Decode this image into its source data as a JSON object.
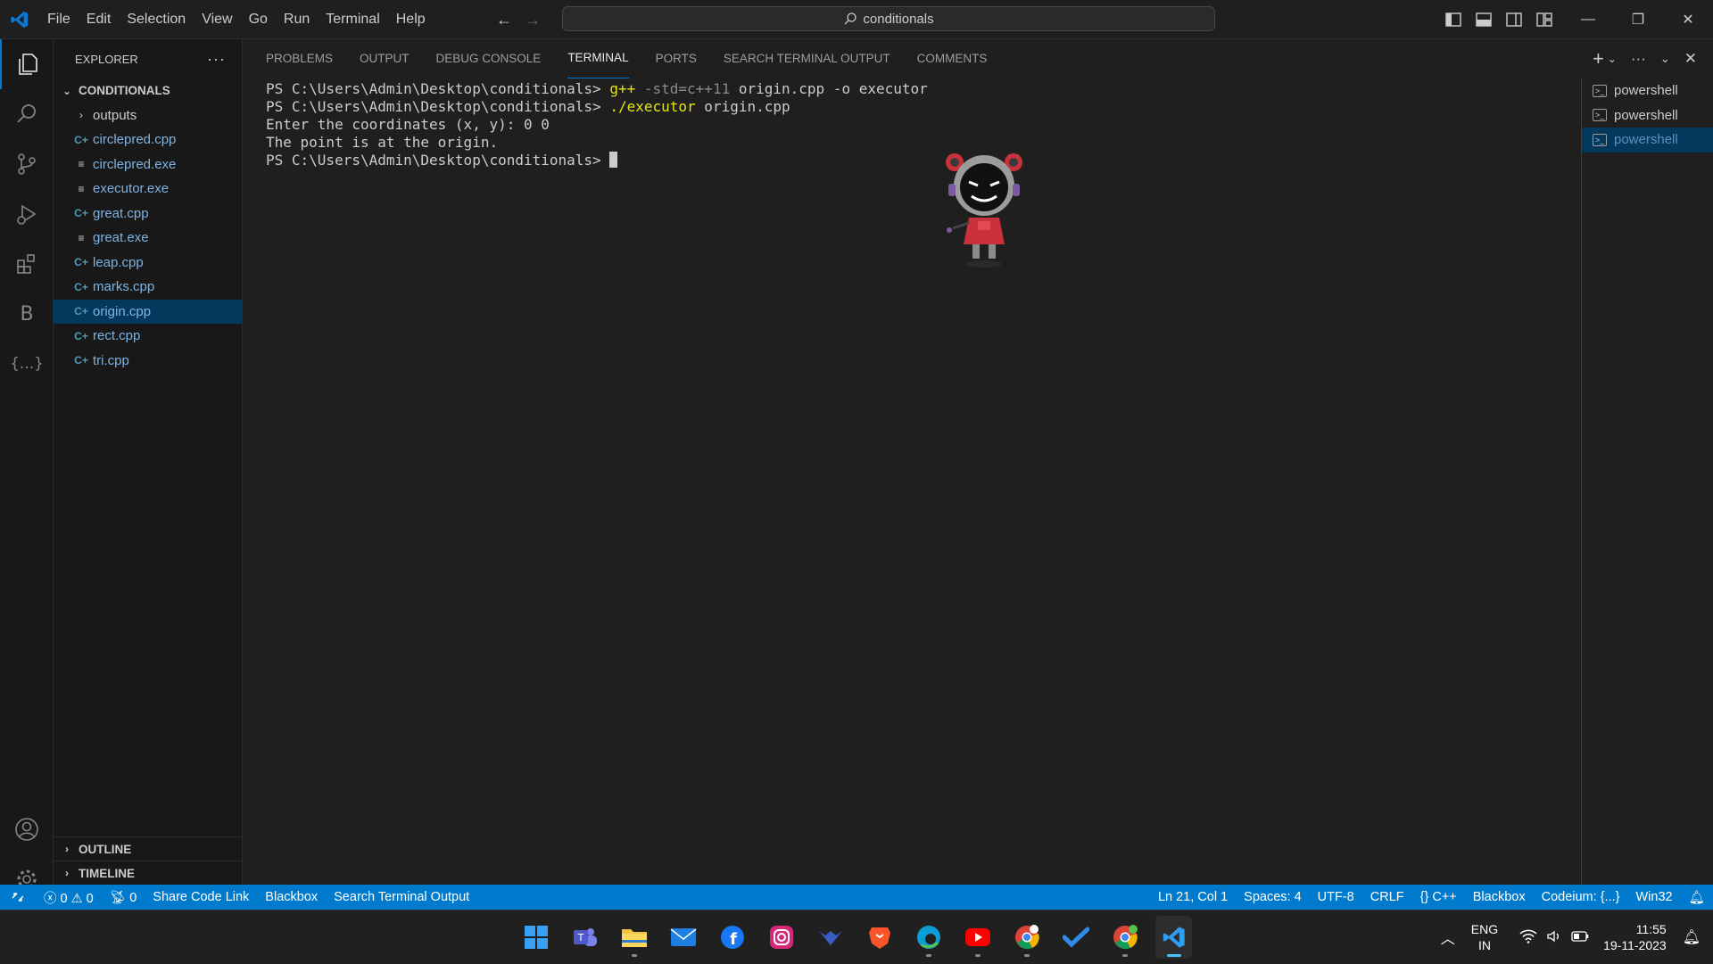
{
  "menu": [
    "File",
    "Edit",
    "Selection",
    "View",
    "Go",
    "Run",
    "Terminal",
    "Help"
  ],
  "command_center": "conditionals",
  "explorer": {
    "title": "EXPLORER",
    "folder": "CONDITIONALS",
    "subfolder": "outputs",
    "files": [
      {
        "name": "circlepred.cpp",
        "type": "cpp"
      },
      {
        "name": "circlepred.exe",
        "type": "exe"
      },
      {
        "name": "executor.exe",
        "type": "exe"
      },
      {
        "name": "great.cpp",
        "type": "cpp"
      },
      {
        "name": "great.exe",
        "type": "exe"
      },
      {
        "name": "leap.cpp",
        "type": "cpp"
      },
      {
        "name": "marks.cpp",
        "type": "cpp"
      },
      {
        "name": "origin.cpp",
        "type": "cpp",
        "selected": true
      },
      {
        "name": "rect.cpp",
        "type": "cpp"
      },
      {
        "name": "tri.cpp",
        "type": "cpp"
      }
    ],
    "outline": "OUTLINE",
    "timeline": "TIMELINE"
  },
  "panel_tabs": [
    "PROBLEMS",
    "OUTPUT",
    "DEBUG CONSOLE",
    "TERMINAL",
    "PORTS",
    "SEARCH TERMINAL OUTPUT",
    "COMMENTS"
  ],
  "active_tab": "TERMINAL",
  "terminal": {
    "prompt": "PS C:\\Users\\Admin\\Desktop\\conditionals>",
    "line1_cmd": "g++",
    "line1_flag": "-std=c++11",
    "line1_rest": "origin.cpp -o executor",
    "line2_cmd": "./executor",
    "line2_rest": "origin.cpp",
    "line3": "Enter the coordinates (x, y): 0 0",
    "line4": "The point is at the origin."
  },
  "terminals": [
    "powershell",
    "powershell",
    "powershell"
  ],
  "statusbar": {
    "errors": "0",
    "warnings": "0",
    "ports": "0",
    "left_items": [
      "Share Code Link",
      "Blackbox",
      "Search Terminal Output"
    ],
    "position": "Ln 21, Col 1",
    "spaces": "Spaces: 4",
    "encoding": "UTF-8",
    "eol": "CRLF",
    "language": "C++",
    "blackbox": "Blackbox",
    "codeium": "Codeium: {...}",
    "platform": "Win32"
  },
  "taskbar": {
    "apps": [
      "windows-start",
      "teams",
      "file-explorer",
      "mail",
      "facebook",
      "instagram",
      "tidal",
      "brave",
      "edge",
      "youtube",
      "chrome-profile",
      "todo",
      "chrome",
      "vscode"
    ],
    "lang_top": "ENG",
    "lang_bottom": "IN",
    "time": "11:55",
    "date": "19-11-2023"
  },
  "colors": {
    "accent": "#007acc",
    "selection": "#04395e",
    "cmd_yellow": "#e5e510"
  }
}
